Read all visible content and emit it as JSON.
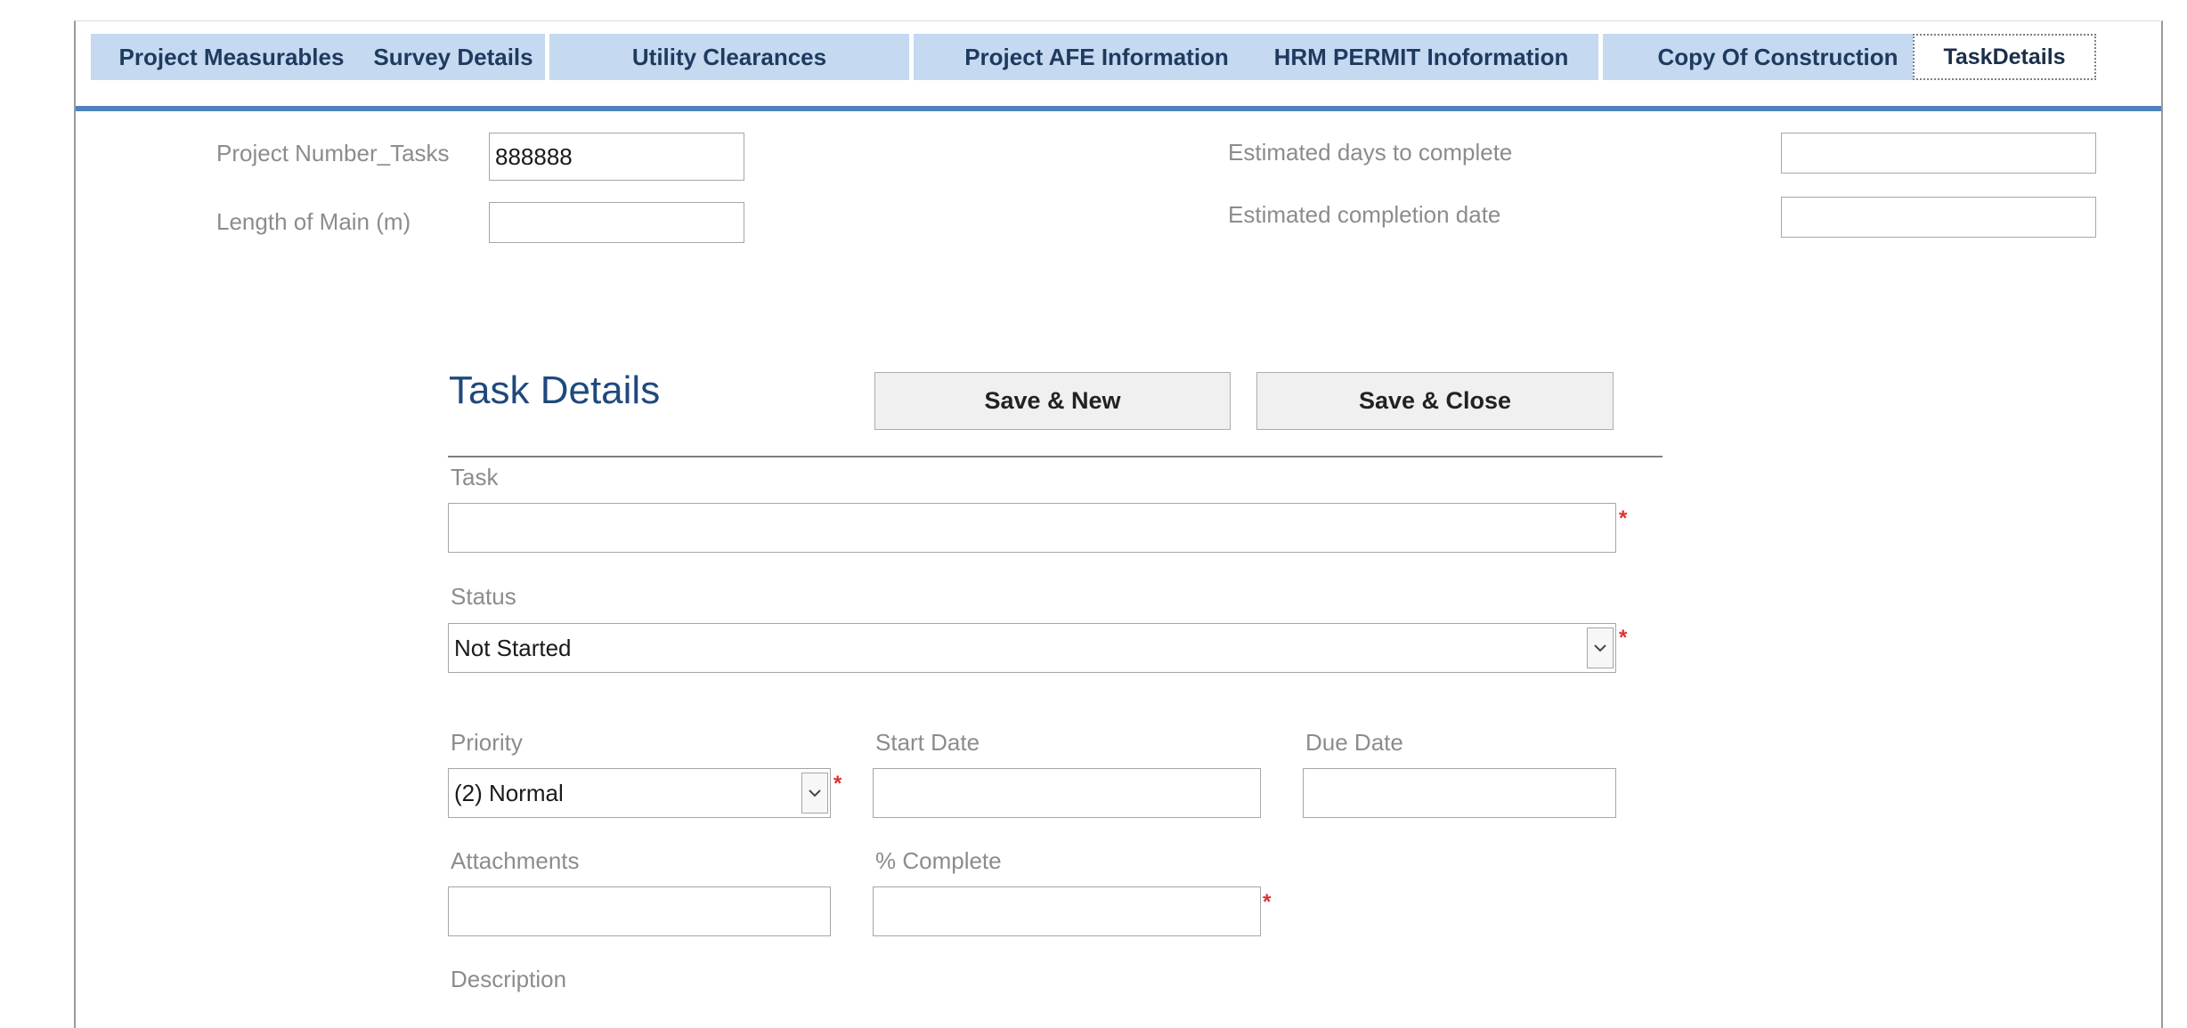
{
  "tabs": [
    {
      "label": "Project Measurables"
    },
    {
      "label": "Survey Details"
    },
    {
      "label": "Utility Clearances"
    },
    {
      "label": "Project AFE Information"
    },
    {
      "label": "HRM PERMIT Inoformation"
    },
    {
      "label": "Copy Of Construction"
    },
    {
      "label": "TaskDetails"
    }
  ],
  "header_fields": {
    "project_number": {
      "label": "Project Number_Tasks",
      "value": "888888"
    },
    "length_of_main": {
      "label": "Length of Main (m)",
      "value": ""
    },
    "estimated_days": {
      "label": "Estimated days to complete",
      "value": ""
    },
    "estimated_completion": {
      "label": "Estimated completion date",
      "value": ""
    }
  },
  "task_form": {
    "title": "Task Details",
    "save_new_label": "Save & New",
    "save_close_label": "Save & Close",
    "task": {
      "label": "Task",
      "value": ""
    },
    "status": {
      "label": "Status",
      "value": "Not Started"
    },
    "priority": {
      "label": "Priority",
      "value": "(2) Normal"
    },
    "start_date": {
      "label": "Start Date",
      "value": ""
    },
    "due_date": {
      "label": "Due Date",
      "value": ""
    },
    "attachments": {
      "label": "Attachments",
      "value": ""
    },
    "percent_complete": {
      "label": "% Complete",
      "value": ""
    },
    "description": {
      "label": "Description"
    },
    "required_marker": "*"
  },
  "colors": {
    "tab_bg": "#c5d9f1",
    "tab_rule": "#4f81bd",
    "title": "#1f497d",
    "required": "#e03030"
  },
  "icons": {
    "dropdown": "chevron-down-icon"
  }
}
